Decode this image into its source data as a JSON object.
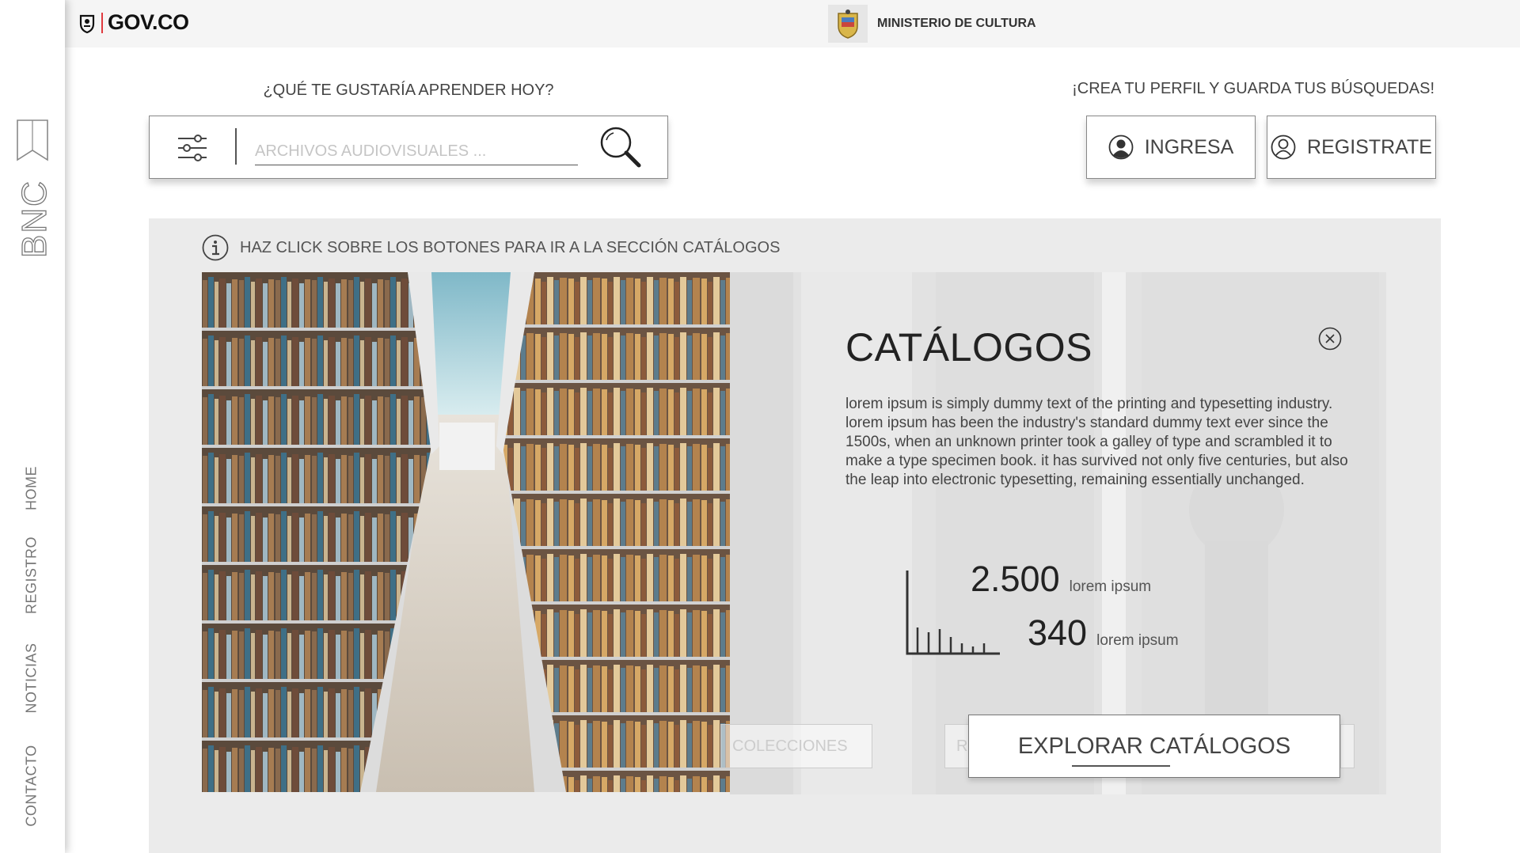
{
  "topbar": {
    "govco_label": "GOV.CO",
    "ministry_name": "MINISTERIO DE CULTURA"
  },
  "sidenav": {
    "logo_text": "BNC",
    "items": [
      {
        "label": "HOME"
      },
      {
        "label": "REGISTRO"
      },
      {
        "label": "NOTICIAS"
      },
      {
        "label": "CONTACTO"
      }
    ]
  },
  "search": {
    "prompt": "¿QUÉ TE GUSTARÍA APRENDER HOY?",
    "placeholder": "ARCHIVOS AUDIOVISUALES ..."
  },
  "account": {
    "prompt": "¡CREA TU PERFIL Y GUARDA TUS BÚSQUEDAS!",
    "login_label": "INGRESA",
    "register_label": "REGISTRATE"
  },
  "main": {
    "info_text": "HAZ CLICK SOBRE LOS BOTONES PARA IR A LA SECCIÓN CATÁLOGOS",
    "background_buttons": [
      "COLECCIONES",
      "R",
      ""
    ],
    "card": {
      "title": "CATÁLOGOS",
      "description": "lorem ipsum is simply dummy text of the printing and typesetting industry. lorem ipsum has been the industry's standard dummy text ever since the 1500s, when an unknown printer took a galley of type and scrambled it to make a type specimen book. it has survived not only five centuries, but also the leap into electronic typesetting, remaining essentially unchanged.",
      "stats": [
        {
          "value": "2.500",
          "label": "lorem ipsum"
        },
        {
          "value": "340",
          "label": "lorem ipsum"
        }
      ],
      "explore_label": "EXPLORAR CATÁLOGOS"
    }
  },
  "colors": {
    "accent_red": "#e0393e",
    "panel_bg": "#ebebeb",
    "topbar_bg": "#f5f5f5"
  }
}
